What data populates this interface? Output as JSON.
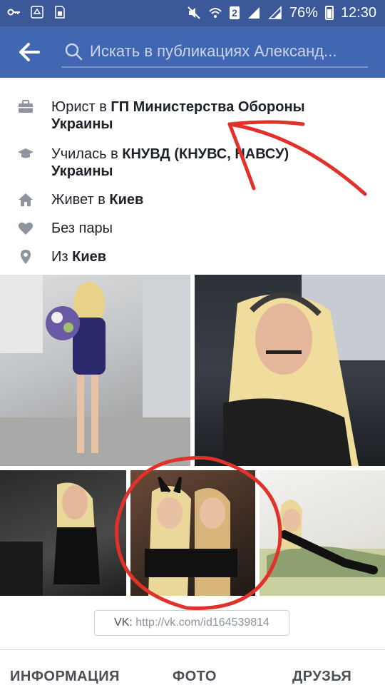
{
  "status_bar": {
    "battery": "76%",
    "time": "12:30",
    "sim_badge": "2"
  },
  "header": {
    "search_placeholder": "Искать в публикациях Александ..."
  },
  "info": {
    "work_prefix": "Юрист в ",
    "work_place_line1": "ГП Министерства Обороны",
    "work_place_line2": "Украины",
    "study_prefix": "Училась в ",
    "study_place_line1": "КНУВД (КНУВС, НАВСУ)",
    "study_place_line2": "Украины",
    "lives_prefix": "Живет в ",
    "lives_city": "Киев",
    "relationship": "Без пары",
    "from_prefix": "Из ",
    "from_city": "Киев"
  },
  "vk": {
    "label": "VK: ",
    "url": "http://vk.com/id164539814"
  },
  "tabs": {
    "info": "ИНФОРМАЦИЯ",
    "photos": "ФОТО",
    "friends": "ДРУЗЬЯ"
  },
  "colors": {
    "status_bar": "#3b5998",
    "header": "#4267b2",
    "annotation_red": "#e0312b",
    "text_dark": "#1d2129",
    "icon_gray": "#8d949e"
  }
}
